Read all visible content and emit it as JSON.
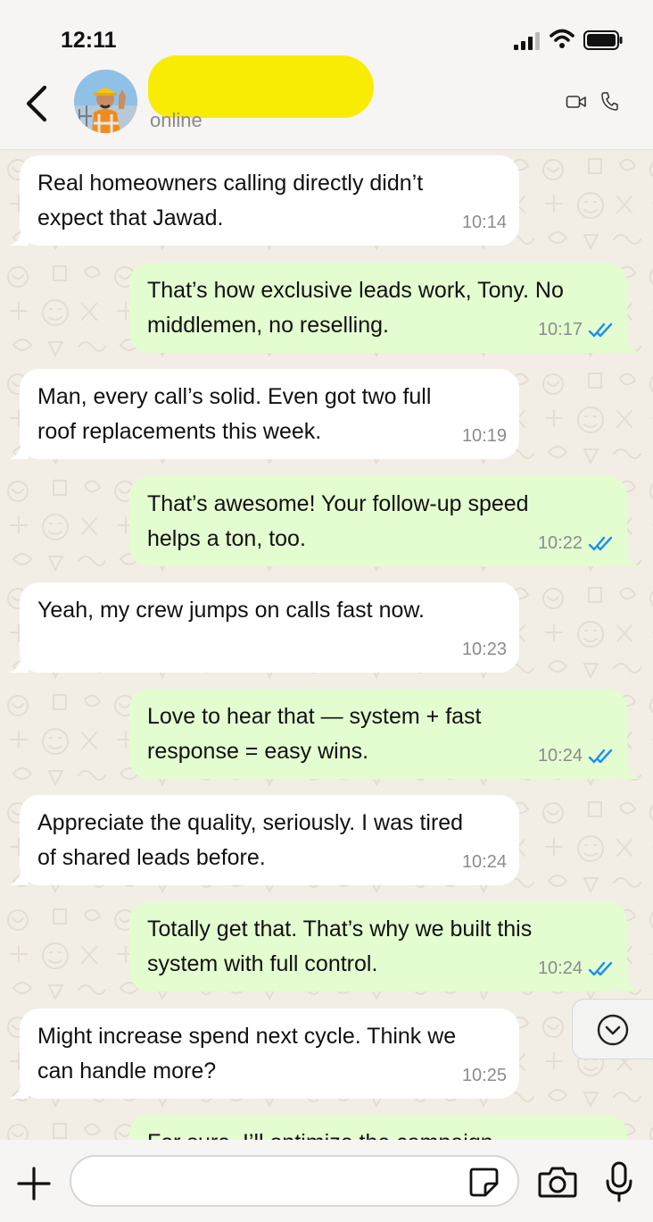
{
  "status_bar": {
    "time": "12:11",
    "icons": [
      "signal-icon",
      "wifi-icon",
      "battery-icon"
    ]
  },
  "header": {
    "back_icon": "chevron-left-icon",
    "contact_status": "online",
    "actions": [
      "video-call-icon",
      "phone-icon"
    ]
  },
  "messages": [
    {
      "direction": "in",
      "text": "Real homeowners calling directly didn’t expect that Jawad.",
      "time": "10:14"
    },
    {
      "direction": "out",
      "text": "That’s how exclusive leads work, Tony. No middlemen, no reselling.",
      "time": "10:17",
      "read": true
    },
    {
      "direction": "in",
      "text": "Man, every call’s solid. Even got two full roof replacements this week.",
      "time": "10:19"
    },
    {
      "direction": "out",
      "text": "That’s awesome! Your follow-up speed helps a ton, too.",
      "time": "10:22",
      "read": true
    },
    {
      "direction": "in",
      "text": "Yeah, my crew jumps on calls fast now.",
      "time": "10:23"
    },
    {
      "direction": "out",
      "text": "Love to hear that — system + fast response = easy wins.",
      "time": "10:24",
      "read": true
    },
    {
      "direction": "in",
      "text": "Appreciate the quality, seriously. I was tired of shared leads before.",
      "time": "10:24"
    },
    {
      "direction": "out",
      "text": "Totally get that. That’s why we built this system with full control.",
      "time": "10:24",
      "read": true
    },
    {
      "direction": "in",
      "text": "Might increase spend next cycle. Think we can handle more?",
      "time": "10:25"
    },
    {
      "direction": "out",
      "text": "For sure. I’ll optimize the campaign",
      "time": "",
      "read": true
    }
  ],
  "input_bar": {
    "placeholder": "",
    "value": "",
    "icons": [
      "plus-icon",
      "sticker-icon",
      "camera-icon",
      "microphone-icon"
    ]
  },
  "colors": {
    "incoming_bubble": "#ffffff",
    "outgoing_bubble": "#e3fdd0",
    "read_ticks": "#1d8ef0",
    "name_redaction": "#f8ec05"
  }
}
